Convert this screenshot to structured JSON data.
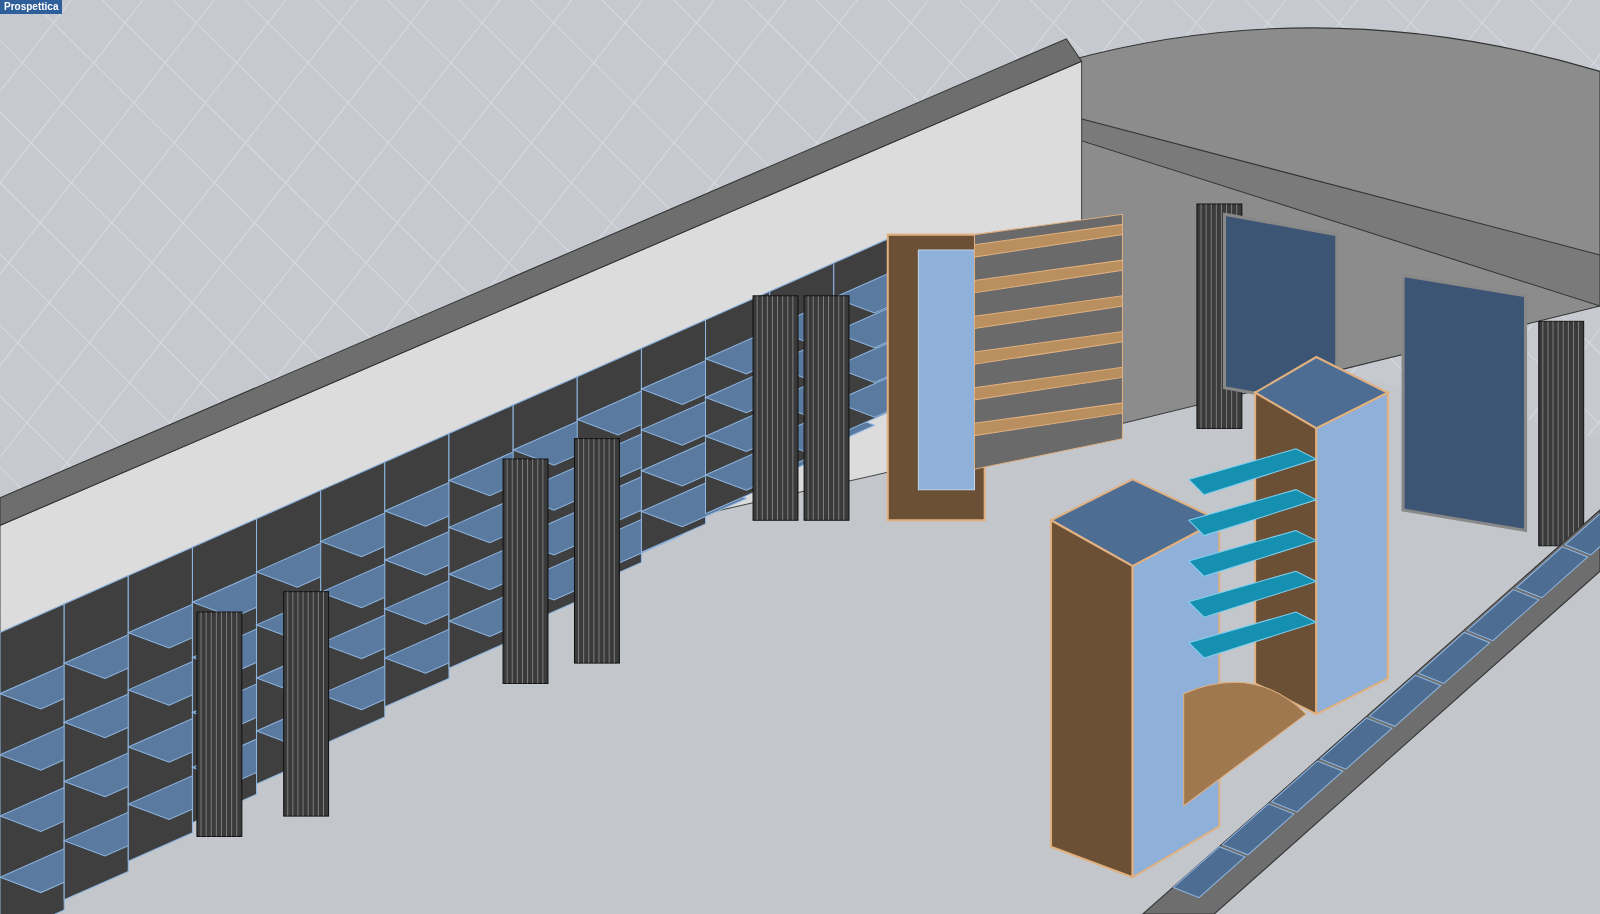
{
  "viewport": {
    "label": "Prospettica"
  }
}
